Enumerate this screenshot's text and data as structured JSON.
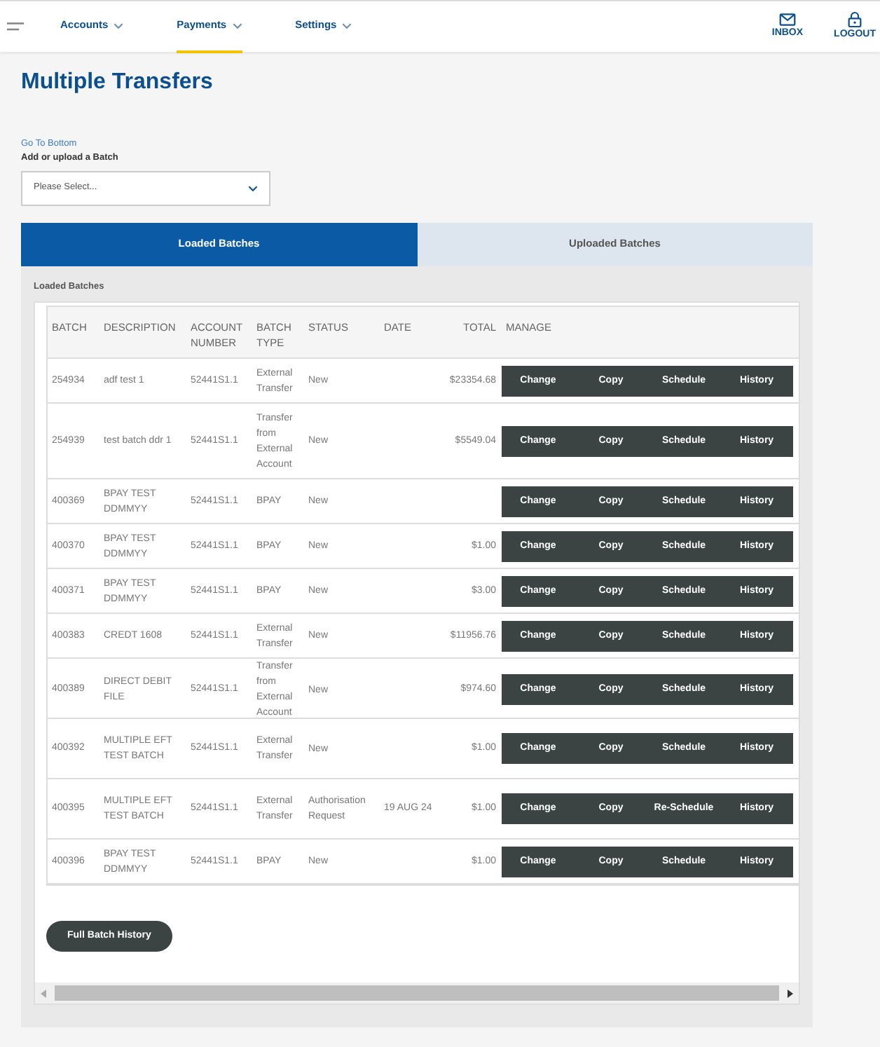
{
  "nav": {
    "items": [
      {
        "label": "Accounts",
        "selected": false
      },
      {
        "label": "Payments",
        "selected": true
      },
      {
        "label": "Settings",
        "selected": false
      }
    ],
    "actions": [
      {
        "kind": "mail",
        "label": "INBOX"
      },
      {
        "kind": "lock",
        "label": "LOGOUT"
      }
    ]
  },
  "page": {
    "title": "Multiple Transfers",
    "link": "Go To Bottom",
    "select_label": "Add or upload a Batch",
    "select": {
      "placeholder": "Please Select..."
    }
  },
  "tabs": [
    {
      "label": "Loaded Batches",
      "selected": true
    },
    {
      "label": "Uploaded Batches",
      "selected": false
    }
  ],
  "section_title": "Loaded Batches",
  "table": {
    "columns": [
      "BATCH",
      "DESCRIPTION",
      "ACCOUNT NUMBER",
      "BATCH TYPE",
      "STATUS",
      "DATE",
      "TOTAL",
      "MANAGE"
    ],
    "rows": [
      {
        "batch": "254934",
        "description": "adf test 1",
        "account": "52441S1.1",
        "type": "External Transfer",
        "status": "New",
        "date": "",
        "total": "$23354.68",
        "actions": [
          "Change",
          "Copy",
          "Schedule",
          "History"
        ]
      },
      {
        "batch": "254939",
        "description": "test batch ddr 1",
        "account": "52441S1.1",
        "type": "Transfer from External Account",
        "status": "New",
        "date": "",
        "total": "$5549.04",
        "actions": [
          "Change",
          "Copy",
          "Schedule",
          "History"
        ]
      },
      {
        "batch": "400369",
        "description": "BPAY TEST DDMMYY",
        "account": "52441S1.1",
        "type": "BPAY",
        "status": "New",
        "date": "",
        "total": "",
        "actions": [
          "Change",
          "Copy",
          "Schedule",
          "History"
        ]
      },
      {
        "batch": "400370",
        "description": "BPAY TEST DDMMYY",
        "account": "52441S1.1",
        "type": "BPAY",
        "status": "New",
        "date": "",
        "total": "$1.00",
        "actions": [
          "Change",
          "Copy",
          "Schedule",
          "History"
        ]
      },
      {
        "batch": "400371",
        "description": "BPAY TEST DDMMYY",
        "account": "52441S1.1",
        "type": "BPAY",
        "status": "New",
        "date": "",
        "total": "$3.00",
        "actions": [
          "Change",
          "Copy",
          "Schedule",
          "History"
        ]
      },
      {
        "batch": "400383",
        "description": "CREDT 1608",
        "account": "52441S1.1",
        "type": "External Transfer",
        "status": "New",
        "date": "",
        "total": "$11956.76",
        "actions": [
          "Change",
          "Copy",
          "Schedule",
          "History"
        ]
      },
      {
        "batch": "400389",
        "description": "DIRECT DEBIT FILE",
        "account": "52441S1.1",
        "type": "Transfer from External Account",
        "status": "New",
        "date": "",
        "total": "$974.60",
        "actions": [
          "Change",
          "Copy",
          "Schedule",
          "History"
        ]
      },
      {
        "batch": "400392",
        "description": "MULTIPLE EFT TEST BATCH",
        "account": "52441S1.1",
        "type": "External Transfer",
        "status": "New",
        "date": "",
        "total": "$1.00",
        "actions": [
          "Change",
          "Copy",
          "Schedule",
          "History"
        ]
      },
      {
        "batch": "400395",
        "description": "MULTIPLE EFT TEST BATCH",
        "account": "52441S1.1",
        "type": "External Transfer",
        "status": "Authorisation Request",
        "date": "19 AUG 24",
        "total": "$1.00",
        "actions": [
          "Change",
          "Copy",
          "Re-Schedule",
          "History"
        ]
      },
      {
        "batch": "400396",
        "description": "BPAY TEST DDMMYY",
        "account": "52441S1.1",
        "type": "BPAY",
        "status": "New",
        "date": "",
        "total": "$1.00",
        "actions": [
          "Change",
          "Copy",
          "Schedule",
          "History"
        ]
      }
    ]
  },
  "history_button": "Full Batch History"
}
